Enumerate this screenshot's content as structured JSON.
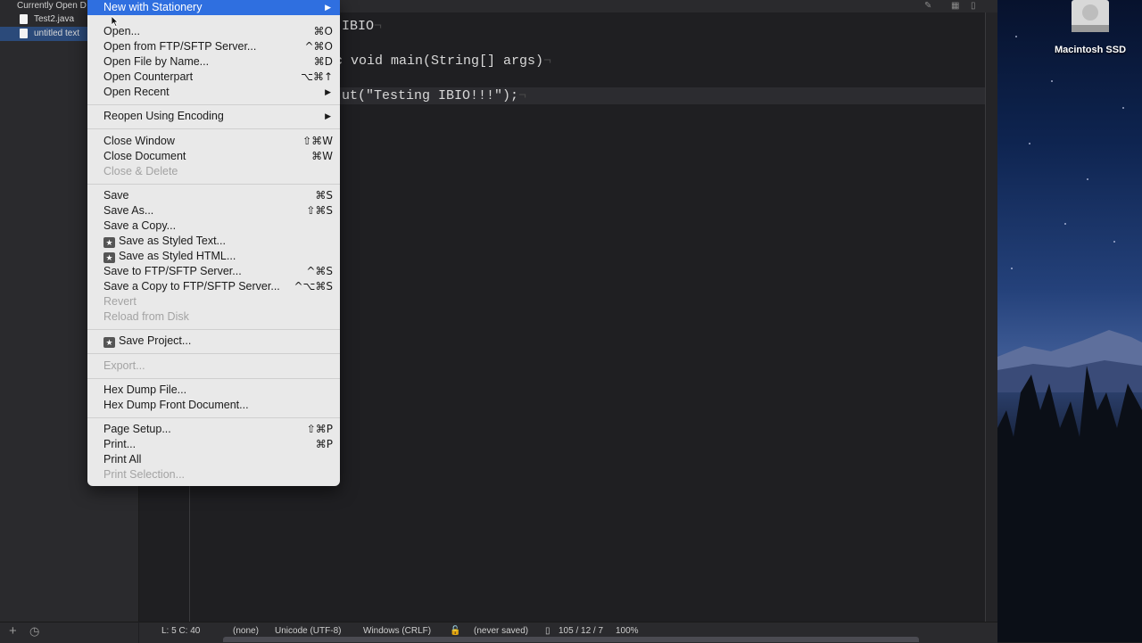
{
  "sidebar": {
    "header": "Currently Open D",
    "items": [
      {
        "label": "Test2.java"
      },
      {
        "label": "untitled text"
      }
    ]
  },
  "code": {
    "line1": "IBIO",
    "line2": "c void main(String[] args)",
    "line3": "ut(\"Testing IBIO!!!\");"
  },
  "menu": {
    "items": [
      {
        "label": "New with Stationery",
        "shortcut": "",
        "submenu": true
      },
      {
        "label": "Open...",
        "shortcut": "⌘O"
      },
      {
        "label": "Open from FTP/SFTP Server...",
        "shortcut": "^⌘O"
      },
      {
        "label": "Open File by Name...",
        "shortcut": "⌘D"
      },
      {
        "label": "Open Counterpart",
        "shortcut": "⌥⌘↑"
      },
      {
        "label": "Open Recent",
        "shortcut": "",
        "submenu": true
      },
      {
        "label": "Reopen Using Encoding",
        "shortcut": "",
        "submenu": true
      },
      {
        "label": "Close Window",
        "shortcut": "⇧⌘W"
      },
      {
        "label": "Close Document",
        "shortcut": "⌘W"
      },
      {
        "label": "Close & Delete",
        "shortcut": ""
      },
      {
        "label": "Save",
        "shortcut": "⌘S"
      },
      {
        "label": "Save As...",
        "shortcut": "⇧⌘S"
      },
      {
        "label": "Save a Copy...",
        "shortcut": ""
      },
      {
        "label": "Save as Styled Text...",
        "shortcut": ""
      },
      {
        "label": "Save as Styled HTML...",
        "shortcut": ""
      },
      {
        "label": "Save to FTP/SFTP Server...",
        "shortcut": "^⌘S"
      },
      {
        "label": "Save a Copy to FTP/SFTP Server...",
        "shortcut": "^⌥⌘S"
      },
      {
        "label": "Revert",
        "shortcut": ""
      },
      {
        "label": "Reload from Disk",
        "shortcut": ""
      },
      {
        "label": "Save Project...",
        "shortcut": ""
      },
      {
        "label": "Export...",
        "shortcut": ""
      },
      {
        "label": "Hex Dump File...",
        "shortcut": ""
      },
      {
        "label": "Hex Dump Front Document...",
        "shortcut": ""
      },
      {
        "label": "Page Setup...",
        "shortcut": "⇧⌘P"
      },
      {
        "label": "Print...",
        "shortcut": "⌘P"
      },
      {
        "label": "Print All",
        "shortcut": ""
      },
      {
        "label": "Print Selection...",
        "shortcut": ""
      }
    ]
  },
  "statusbar": {
    "position": "L: 5 C: 40",
    "language": "(none)",
    "encoding": "Unicode (UTF-8)",
    "line_endings": "Windows (CRLF)",
    "saved_state": "(never saved)",
    "counts": "105 / 12 / 7",
    "zoom": "100%"
  },
  "desktop": {
    "disk_label": "Macintosh SSD"
  }
}
